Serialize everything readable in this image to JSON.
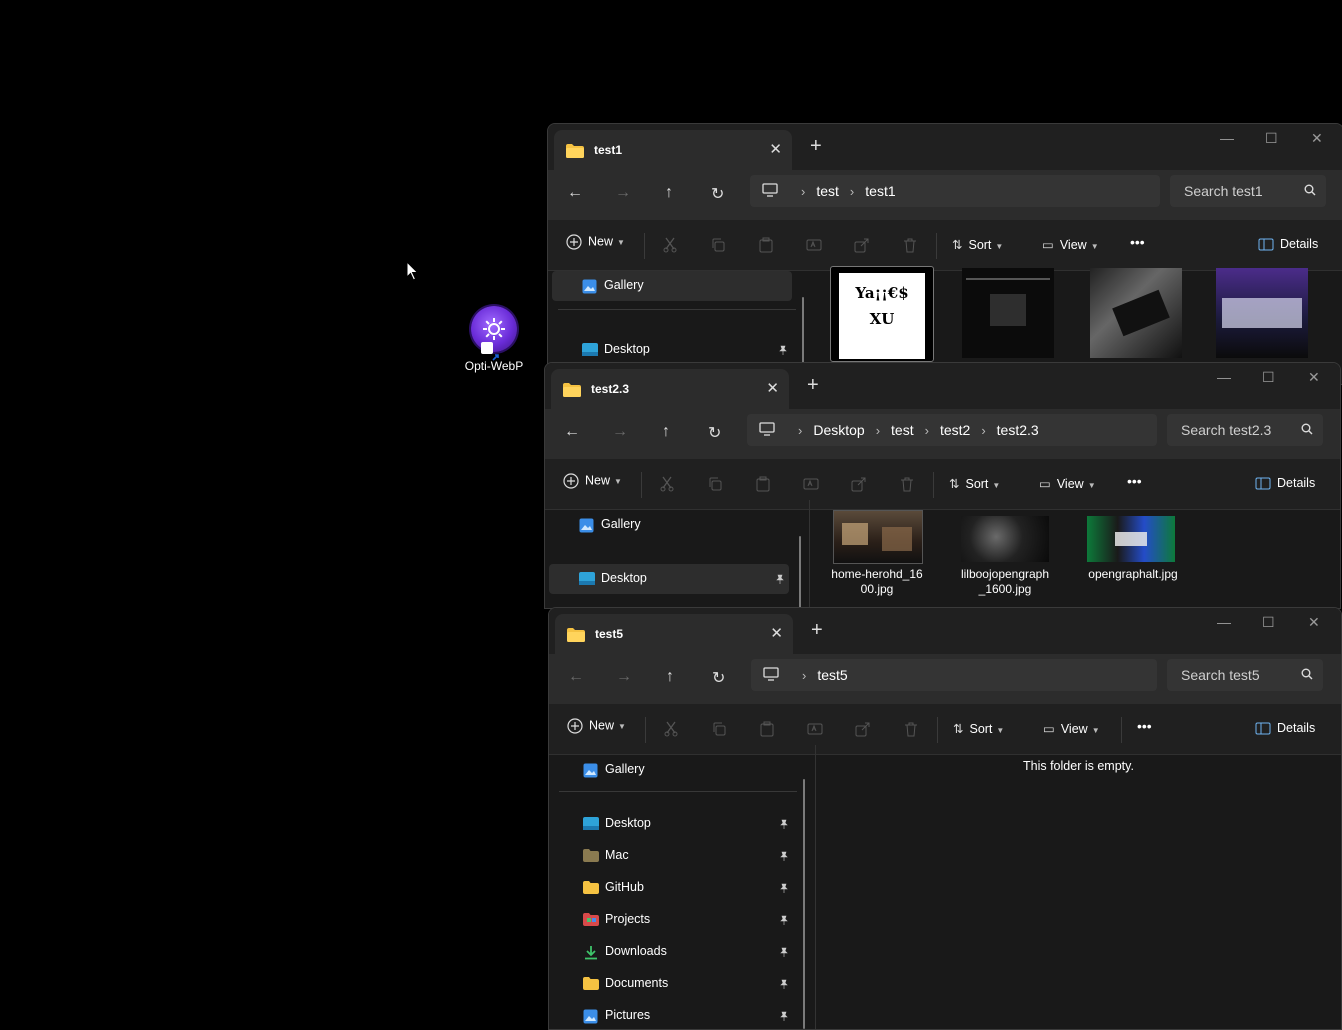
{
  "desktop": {
    "icon_label": "Opti-WebP",
    "icon_name": "opti-webp-gear-icon"
  },
  "windows": [
    {
      "tab_title": "test1",
      "breadcrumbs": [
        "test",
        "test1"
      ],
      "search_placeholder": "Search test1",
      "nav_items": [
        "Gallery",
        "Desktop"
      ],
      "thumbnails": [
        "Ya¡¡€$ XU"
      ]
    },
    {
      "tab_title": "test2.3",
      "breadcrumbs": [
        "Desktop",
        "test",
        "test2",
        "test2.3"
      ],
      "search_placeholder": "Search test2.3",
      "nav_items": [
        "Gallery",
        "Desktop"
      ],
      "files": [
        {
          "name": "home-herohd_16\n00.jpg"
        },
        {
          "name": "lilboojopengraph\n_1600.jpg"
        },
        {
          "name": "opengraphalt.jpg"
        }
      ]
    },
    {
      "tab_title": "test5",
      "breadcrumbs": [
        "test5"
      ],
      "search_placeholder": "Search test5",
      "nav_items": [
        "Gallery",
        "Desktop",
        "Mac",
        "GitHub",
        "Projects",
        "Downloads",
        "Documents",
        "Pictures"
      ],
      "empty_message": "This folder is empty."
    }
  ],
  "commands": {
    "new": "New",
    "sort": "Sort",
    "view": "View",
    "details": "Details",
    "more": "•••"
  },
  "colors": {
    "folder": "#f5c242",
    "accent": "#6a2cd8"
  }
}
